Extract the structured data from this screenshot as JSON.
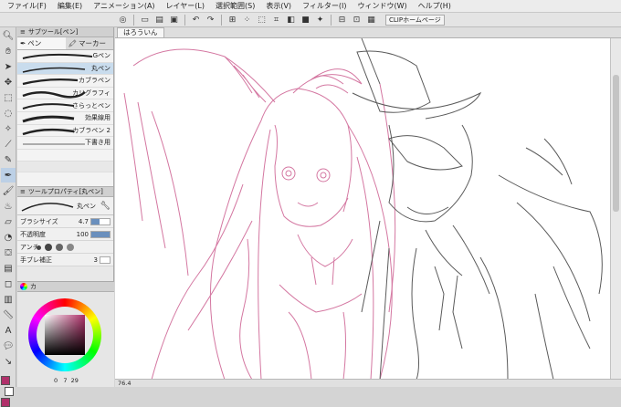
{
  "menu": [
    "ファイル(F)",
    "編集(E)",
    "アニメーション(A)",
    "レイヤー(L)",
    "選択範囲(S)",
    "表示(V)",
    "フィルター(I)",
    "ウィンドウ(W)",
    "ヘルプ(H)"
  ],
  "command_bar": {
    "icons": [
      "swirl-icon",
      "new-icon",
      "open-icon",
      "save-icon",
      "undo-icon",
      "redo-icon",
      "transform-icon",
      "select-all-icon",
      "deselect-icon",
      "crop-icon",
      "invert-icon",
      "fill-icon",
      "sparkle-icon",
      "snap-icon",
      "ruler-icon",
      "window-icon"
    ],
    "clip_label": "CLIPホームページ"
  },
  "sub_tool": {
    "title": "サブツール[ペン]",
    "tabs": [
      "ペン",
      "マーカー"
    ],
    "brushes": [
      "Gペン",
      "丸ペン",
      "カブラペン",
      "カリグラフィ",
      "さらっとペン",
      "効果線用",
      "カブラペン 2",
      "下書き用"
    ],
    "selected_index": 1
  },
  "tool_property": {
    "title": "ツールプロパティ[丸ペン]",
    "brush_name": "丸ペン",
    "rows": [
      {
        "label": "ブラシサイズ",
        "value": "4.7",
        "fill": 0.45
      },
      {
        "label": "不透明度",
        "value": "100",
        "fill": 1.0
      }
    ],
    "aa_label": "アンチ",
    "stabilize_label": "手ブレ補正",
    "stabilize_value": "3",
    "colors": {
      "accent": "#b0306a",
      "selection": "#c9dced",
      "hue": "#b0306a"
    }
  },
  "color_panel": {
    "tab": "カ",
    "readouts": [
      "0",
      "7",
      "29"
    ]
  },
  "canvas": {
    "tab_title": "はろういん",
    "zoom": "76.4",
    "line_colors": {
      "pink": "#d477a1",
      "gray": "#5a5a5a"
    }
  }
}
